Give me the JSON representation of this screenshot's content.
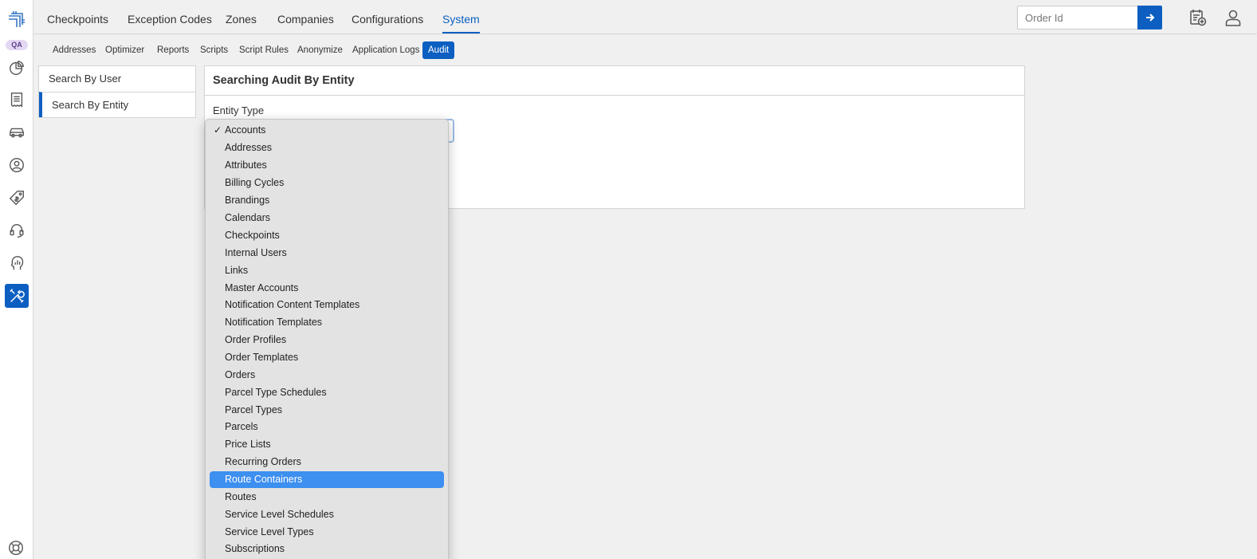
{
  "environment_badge": "QA",
  "rail_icons": [
    "dashboard-pie-icon",
    "receipt-icon",
    "car-icon",
    "user-circle-icon",
    "price-tag-icon",
    "headset-icon",
    "analytics-head-icon",
    "tools-icon"
  ],
  "top_tabs": [
    "Checkpoints",
    "Exception Codes",
    "Zones",
    "Companies",
    "Configurations",
    "System"
  ],
  "active_top_tab": "System",
  "order_search": {
    "placeholder": "Order Id",
    "value": ""
  },
  "sub_tabs": [
    "Addresses",
    "Optimizer",
    "Reports",
    "Scripts",
    "Script Rules",
    "Anonymize",
    "Application Logs",
    "Audit"
  ],
  "active_sub_tab": "Audit",
  "side_menu": [
    "Search By User",
    "Search By Entity"
  ],
  "active_side_item": "Search By Entity",
  "panel": {
    "title": "Searching Audit By Entity",
    "entity_type_label": "Entity Type"
  },
  "dropdown": {
    "selected": "Accounts",
    "highlighted": "Route Containers",
    "options": [
      "Accounts",
      "Addresses",
      "Attributes",
      "Billing Cycles",
      "Brandings",
      "Calendars",
      "Checkpoints",
      "Internal Users",
      "Links",
      "Master Accounts",
      "Notification Content Templates",
      "Notification Templates",
      "Order Profiles",
      "Order Templates",
      "Orders",
      "Parcel Type Schedules",
      "Parcel Types",
      "Parcels",
      "Price Lists",
      "Recurring Orders",
      "Route Containers",
      "Routes",
      "Service Level Schedules",
      "Service Level Types",
      "Subscriptions"
    ]
  },
  "colors": {
    "accent": "#0c5fc1",
    "highlight": "#3d8ff0",
    "background": "#f0f0f0"
  }
}
